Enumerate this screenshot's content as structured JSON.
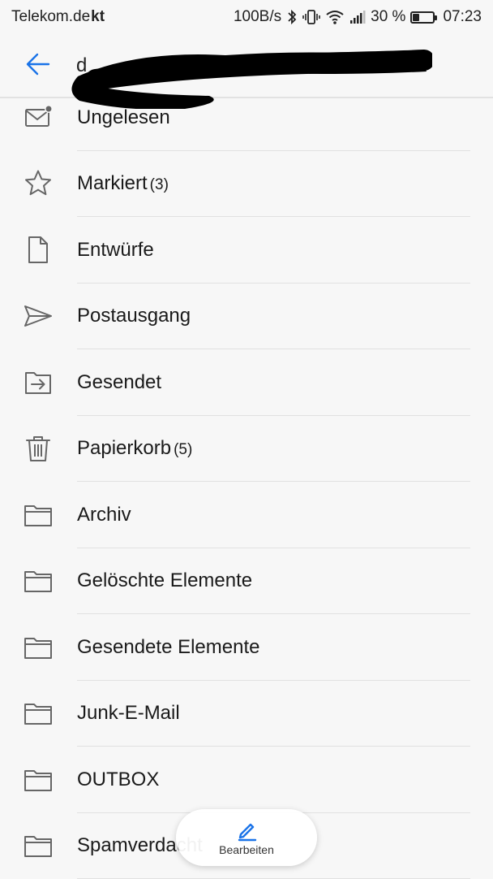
{
  "status_bar": {
    "carrier": "Telekom.de",
    "carrier_suffix": "kt",
    "network_speed": "100B/s",
    "battery_percent": "30 %",
    "battery_level": 0.3,
    "time": "07:23",
    "icons": [
      "bluetooth-icon",
      "vibrate-icon",
      "wifi-icon",
      "signal-icon",
      "battery-icon"
    ]
  },
  "header": {
    "back_icon": "arrow-left-icon",
    "account_title": "d",
    "accent_color": "#1a73e8"
  },
  "folders": [
    {
      "icon": "mail-unread-icon",
      "label": "Ungelesen",
      "count": ""
    },
    {
      "icon": "star-icon",
      "label": "Markiert",
      "count": "(3)"
    },
    {
      "icon": "document-icon",
      "label": "Entwürfe",
      "count": ""
    },
    {
      "icon": "send-icon",
      "label": "Postausgang",
      "count": ""
    },
    {
      "icon": "sent-folder-icon",
      "label": "Gesendet",
      "count": ""
    },
    {
      "icon": "trash-icon",
      "label": "Papierkorb",
      "count": "(5)"
    },
    {
      "icon": "folder-icon",
      "label": "Archiv",
      "count": ""
    },
    {
      "icon": "folder-icon",
      "label": "Gelöschte Elemente",
      "count": ""
    },
    {
      "icon": "folder-icon",
      "label": "Gesendete Elemente",
      "count": ""
    },
    {
      "icon": "folder-icon",
      "label": "Junk-E-Mail",
      "count": ""
    },
    {
      "icon": "folder-icon",
      "label": "OUTBOX",
      "count": ""
    },
    {
      "icon": "folder-icon",
      "label": "Spamverdacht",
      "count": ""
    }
  ],
  "edit_button": {
    "label": "Bearbeiten",
    "icon": "pencil-icon"
  }
}
